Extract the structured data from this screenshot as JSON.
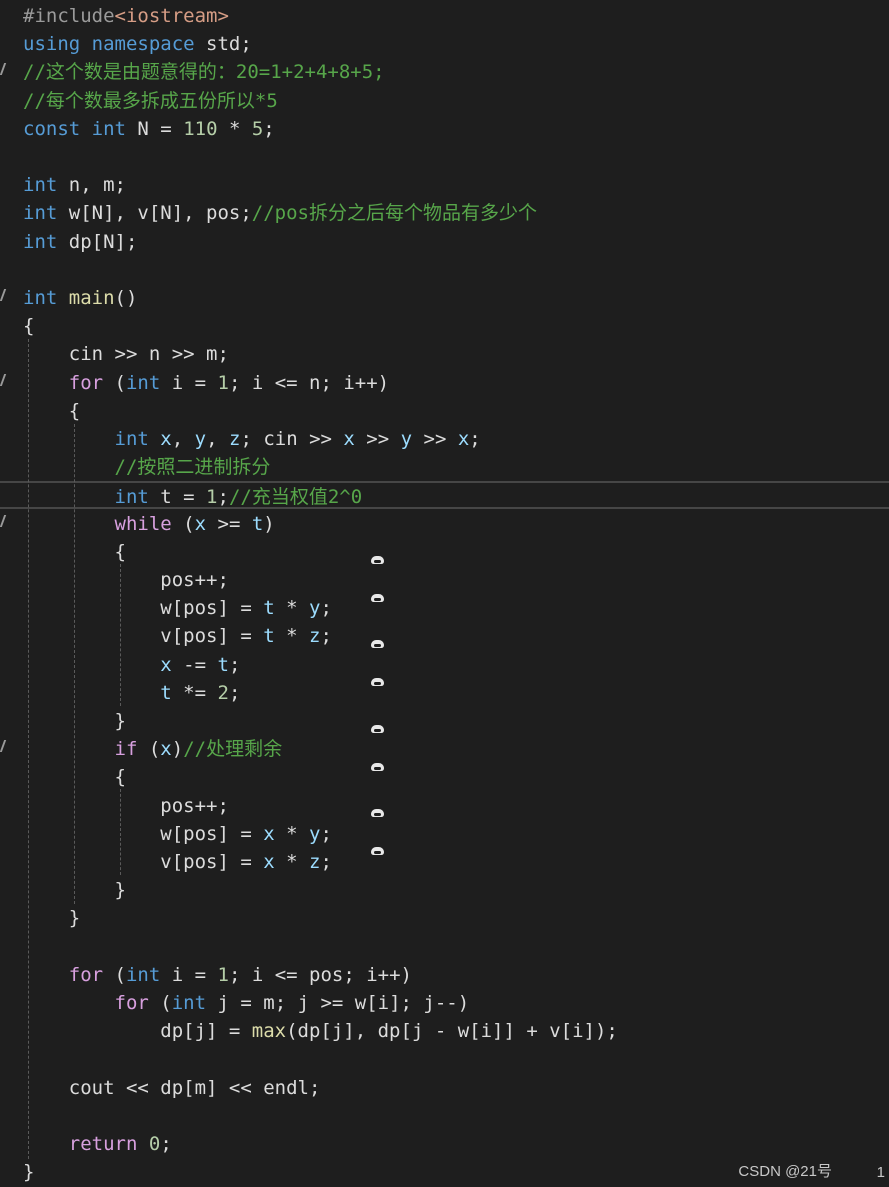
{
  "lines": [
    {
      "mark": false,
      "current": false,
      "tokens": [
        {
          "t": "#include",
          "c": "pp"
        },
        {
          "t": "<iostream>",
          "c": "inc"
        }
      ]
    },
    {
      "mark": false,
      "current": false,
      "tokens": [
        {
          "t": "using",
          "c": "kw"
        },
        {
          "t": " ",
          "c": "plain"
        },
        {
          "t": "namespace",
          "c": "kw"
        },
        {
          "t": " std;",
          "c": "plain"
        }
      ]
    },
    {
      "mark": true,
      "current": false,
      "tokens": [
        {
          "t": "//这个数是由题意得的：20=1+2+4+8+5;",
          "c": "com"
        }
      ]
    },
    {
      "mark": false,
      "current": false,
      "tokens": [
        {
          "t": "//每个数最多拆成五份所以*5",
          "c": "com"
        }
      ]
    },
    {
      "mark": false,
      "current": false,
      "tokens": [
        {
          "t": "const",
          "c": "kw"
        },
        {
          "t": " ",
          "c": "plain"
        },
        {
          "t": "int",
          "c": "kw"
        },
        {
          "t": " N = ",
          "c": "plain"
        },
        {
          "t": "110",
          "c": "num"
        },
        {
          "t": " * ",
          "c": "plain"
        },
        {
          "t": "5",
          "c": "num"
        },
        {
          "t": ";",
          "c": "plain"
        }
      ]
    },
    {
      "mark": false,
      "current": false,
      "tokens": []
    },
    {
      "mark": false,
      "current": false,
      "tokens": [
        {
          "t": "int",
          "c": "kw"
        },
        {
          "t": " n, m;",
          "c": "plain"
        }
      ]
    },
    {
      "mark": false,
      "current": false,
      "tokens": [
        {
          "t": "int",
          "c": "kw"
        },
        {
          "t": " w[N], v[N], pos;",
          "c": "plain"
        },
        {
          "t": "//pos拆分之后每个物品有多少个",
          "c": "com"
        }
      ]
    },
    {
      "mark": false,
      "current": false,
      "tokens": [
        {
          "t": "int",
          "c": "kw"
        },
        {
          "t": " dp[N];",
          "c": "plain"
        }
      ]
    },
    {
      "mark": false,
      "current": false,
      "tokens": []
    },
    {
      "mark": true,
      "current": false,
      "tokens": [
        {
          "t": "int",
          "c": "kw"
        },
        {
          "t": " ",
          "c": "plain"
        },
        {
          "t": "main",
          "c": "fn"
        },
        {
          "t": "()",
          "c": "plain"
        }
      ]
    },
    {
      "mark": false,
      "current": false,
      "tokens": [
        {
          "t": "{",
          "c": "plain"
        }
      ]
    },
    {
      "mark": false,
      "current": false,
      "tokens": [
        {
          "t": "    cin >> n >> m;",
          "c": "plain"
        }
      ]
    },
    {
      "mark": true,
      "current": false,
      "tokens": [
        {
          "t": "    ",
          "c": "plain"
        },
        {
          "t": "for",
          "c": "ctl"
        },
        {
          "t": " (",
          "c": "plain"
        },
        {
          "t": "int",
          "c": "kw"
        },
        {
          "t": " i = ",
          "c": "plain"
        },
        {
          "t": "1",
          "c": "num"
        },
        {
          "t": "; i <= n; i++)",
          "c": "plain"
        }
      ]
    },
    {
      "mark": false,
      "current": false,
      "tokens": [
        {
          "t": "    {",
          "c": "plain"
        }
      ]
    },
    {
      "mark": false,
      "current": false,
      "tokens": [
        {
          "t": "        ",
          "c": "plain"
        },
        {
          "t": "int",
          "c": "kw"
        },
        {
          "t": " ",
          "c": "plain"
        },
        {
          "t": "x",
          "c": "var"
        },
        {
          "t": ", ",
          "c": "plain"
        },
        {
          "t": "y",
          "c": "var"
        },
        {
          "t": ", ",
          "c": "plain"
        },
        {
          "t": "z",
          "c": "var"
        },
        {
          "t": "; cin >> ",
          "c": "plain"
        },
        {
          "t": "x",
          "c": "var"
        },
        {
          "t": " >> ",
          "c": "plain"
        },
        {
          "t": "y",
          "c": "var"
        },
        {
          "t": " >> ",
          "c": "plain"
        },
        {
          "t": "x",
          "c": "var"
        },
        {
          "t": ";",
          "c": "plain"
        }
      ]
    },
    {
      "mark": false,
      "current": false,
      "tokens": [
        {
          "t": "        ",
          "c": "plain"
        },
        {
          "t": "//按照二进制拆分",
          "c": "com"
        }
      ]
    },
    {
      "mark": false,
      "current": true,
      "tokens": [
        {
          "t": "        ",
          "c": "plain"
        },
        {
          "t": "int",
          "c": "kw"
        },
        {
          "t": " t = ",
          "c": "plain"
        },
        {
          "t": "1",
          "c": "num"
        },
        {
          "t": ";",
          "c": "plain"
        },
        {
          "t": "//充当权值2^0",
          "c": "com"
        }
      ]
    },
    {
      "mark": true,
      "current": false,
      "tokens": [
        {
          "t": "        ",
          "c": "plain"
        },
        {
          "t": "while",
          "c": "ctl"
        },
        {
          "t": " (",
          "c": "plain"
        },
        {
          "t": "x",
          "c": "var"
        },
        {
          "t": " >= ",
          "c": "plain"
        },
        {
          "t": "t",
          "c": "var"
        },
        {
          "t": ")",
          "c": "plain"
        }
      ]
    },
    {
      "mark": false,
      "current": false,
      "tokens": [
        {
          "t": "        {",
          "c": "plain"
        }
      ]
    },
    {
      "mark": false,
      "current": false,
      "tokens": [
        {
          "t": "            pos++;",
          "c": "plain"
        }
      ]
    },
    {
      "mark": false,
      "current": false,
      "tokens": [
        {
          "t": "            w[pos] = ",
          "c": "plain"
        },
        {
          "t": "t",
          "c": "var"
        },
        {
          "t": " * ",
          "c": "plain"
        },
        {
          "t": "y",
          "c": "var"
        },
        {
          "t": ";",
          "c": "plain"
        }
      ]
    },
    {
      "mark": false,
      "current": false,
      "tokens": [
        {
          "t": "            v[pos] = ",
          "c": "plain"
        },
        {
          "t": "t",
          "c": "var"
        },
        {
          "t": " * ",
          "c": "plain"
        },
        {
          "t": "z",
          "c": "var"
        },
        {
          "t": ";",
          "c": "plain"
        }
      ]
    },
    {
      "mark": false,
      "current": false,
      "tokens": [
        {
          "t": "            ",
          "c": "plain"
        },
        {
          "t": "x",
          "c": "var"
        },
        {
          "t": " -= ",
          "c": "plain"
        },
        {
          "t": "t",
          "c": "var"
        },
        {
          "t": ";",
          "c": "plain"
        }
      ]
    },
    {
      "mark": false,
      "current": false,
      "tokens": [
        {
          "t": "            ",
          "c": "plain"
        },
        {
          "t": "t",
          "c": "var"
        },
        {
          "t": " *= ",
          "c": "plain"
        },
        {
          "t": "2",
          "c": "num"
        },
        {
          "t": ";",
          "c": "plain"
        }
      ]
    },
    {
      "mark": false,
      "current": false,
      "tokens": [
        {
          "t": "        }",
          "c": "plain"
        }
      ]
    },
    {
      "mark": true,
      "current": false,
      "tokens": [
        {
          "t": "        ",
          "c": "plain"
        },
        {
          "t": "if",
          "c": "ctl"
        },
        {
          "t": " (",
          "c": "plain"
        },
        {
          "t": "x",
          "c": "var"
        },
        {
          "t": ")",
          "c": "plain"
        },
        {
          "t": "//处理剩余",
          "c": "com"
        }
      ]
    },
    {
      "mark": false,
      "current": false,
      "tokens": [
        {
          "t": "        {",
          "c": "plain"
        }
      ]
    },
    {
      "mark": false,
      "current": false,
      "tokens": [
        {
          "t": "            pos++;",
          "c": "plain"
        }
      ]
    },
    {
      "mark": false,
      "current": false,
      "tokens": [
        {
          "t": "            w[pos] = ",
          "c": "plain"
        },
        {
          "t": "x",
          "c": "var"
        },
        {
          "t": " * ",
          "c": "plain"
        },
        {
          "t": "y",
          "c": "var"
        },
        {
          "t": ";",
          "c": "plain"
        }
      ]
    },
    {
      "mark": false,
      "current": false,
      "tokens": [
        {
          "t": "            v[pos] = ",
          "c": "plain"
        },
        {
          "t": "x",
          "c": "var"
        },
        {
          "t": " * ",
          "c": "plain"
        },
        {
          "t": "z",
          "c": "var"
        },
        {
          "t": ";",
          "c": "plain"
        }
      ]
    },
    {
      "mark": false,
      "current": false,
      "tokens": [
        {
          "t": "        }",
          "c": "plain"
        }
      ]
    },
    {
      "mark": false,
      "current": false,
      "tokens": [
        {
          "t": "    }",
          "c": "plain"
        }
      ]
    },
    {
      "mark": false,
      "current": false,
      "tokens": []
    },
    {
      "mark": false,
      "current": false,
      "tokens": [
        {
          "t": "    ",
          "c": "plain"
        },
        {
          "t": "for",
          "c": "ctl"
        },
        {
          "t": " (",
          "c": "plain"
        },
        {
          "t": "int",
          "c": "kw"
        },
        {
          "t": " i = ",
          "c": "plain"
        },
        {
          "t": "1",
          "c": "num"
        },
        {
          "t": "; i <= pos; i++)",
          "c": "plain"
        }
      ]
    },
    {
      "mark": false,
      "current": false,
      "tokens": [
        {
          "t": "        ",
          "c": "plain"
        },
        {
          "t": "for",
          "c": "ctl"
        },
        {
          "t": " (",
          "c": "plain"
        },
        {
          "t": "int",
          "c": "kw"
        },
        {
          "t": " j = m; j >= w[i]; j--)",
          "c": "plain"
        }
      ]
    },
    {
      "mark": false,
      "current": false,
      "tokens": [
        {
          "t": "            dp[j] = ",
          "c": "plain"
        },
        {
          "t": "max",
          "c": "fn"
        },
        {
          "t": "(dp[j], dp[j - w[i]] + v[i]);",
          "c": "plain"
        }
      ]
    },
    {
      "mark": false,
      "current": false,
      "tokens": []
    },
    {
      "mark": false,
      "current": false,
      "tokens": [
        {
          "t": "    cout << dp[m] << endl;",
          "c": "plain"
        }
      ]
    },
    {
      "mark": false,
      "current": false,
      "tokens": []
    },
    {
      "mark": false,
      "current": false,
      "tokens": [
        {
          "t": "    ",
          "c": "plain"
        },
        {
          "t": "return",
          "c": "ctl"
        },
        {
          "t": " ",
          "c": "plain"
        },
        {
          "t": "0",
          "c": "num"
        },
        {
          "t": ";",
          "c": "plain"
        }
      ]
    },
    {
      "mark": false,
      "current": false,
      "tokens": [
        {
          "t": "}",
          "c": "plain"
        }
      ]
    }
  ],
  "watermark": "CSDN @21号",
  "corner_number": "1",
  "colors": {
    "background": "#1e1e1e",
    "keyword": "#569cd6",
    "control": "#d8a0df",
    "comment": "#57a64a",
    "number": "#b5cea8",
    "variable": "#9cdcfe",
    "function": "#dcdcaa",
    "include": "#d69d85"
  }
}
